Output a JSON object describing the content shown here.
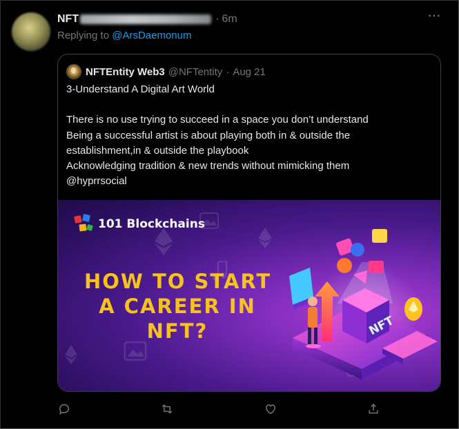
{
  "tweet": {
    "author_name": "NFT",
    "time": "6m",
    "dot": "·",
    "more": "···",
    "replying_prefix": "Replying to",
    "replying_handle": "@ArsDaemonum"
  },
  "quote": {
    "name": "NFTEntity Web3",
    "handle": "@NFTentity",
    "dot": "·",
    "date": "Aug 21",
    "lines": [
      "3-Understand A Digital Art World",
      "",
      "There is no use trying to succeed in a space you don’t understand",
      "Being a successful artist is about playing both in & outside the",
      "establishment,in & outside the playbook",
      "Acknowledging tradition & new trends without mimicking them",
      "@hyprrsocial"
    ],
    "media": {
      "brand": "101 Blockchains",
      "headline": [
        "HOW TO START",
        "A CAREER IN",
        "NFT?"
      ],
      "nft_label": "NFT",
      "colors": {
        "headline": "#f7c21b",
        "bg": "#4a1a8c",
        "accent": "#b23cd6"
      }
    }
  },
  "actions": {
    "icons": [
      "reply-icon",
      "retweet-icon",
      "like-icon",
      "share-icon"
    ]
  },
  "colors": {
    "link": "#1d9bf0",
    "muted": "#71767b",
    "text": "#e7e9ea",
    "bg": "#000000"
  }
}
